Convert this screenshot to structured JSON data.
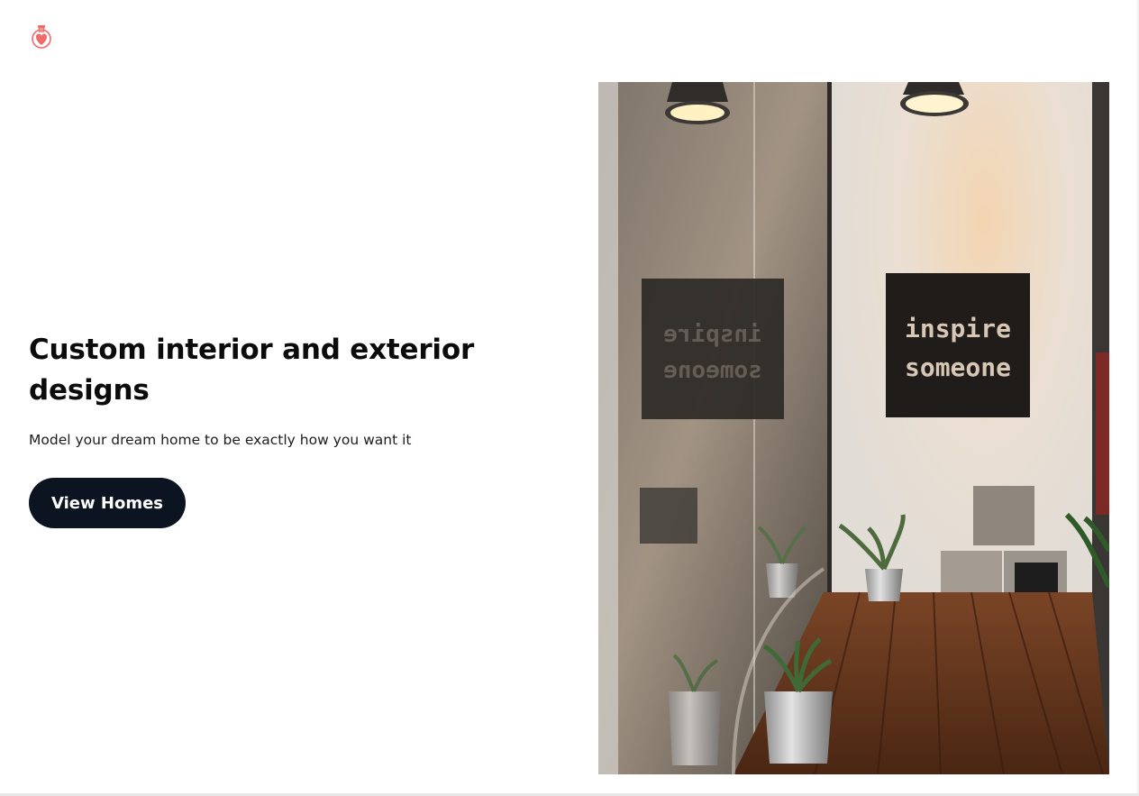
{
  "brand": {
    "logo_icon": "heart-potion-icon",
    "accent_color": "#f06a6a"
  },
  "hero": {
    "title": "Custom interior and exterior designs",
    "subtitle": "Model your dream home to be exactly how you want it",
    "cta_label": "View Homes",
    "cta_color": "#0d1421"
  },
  "photo": {
    "sign_line_1": "inspire",
    "sign_line_2": "someone"
  }
}
